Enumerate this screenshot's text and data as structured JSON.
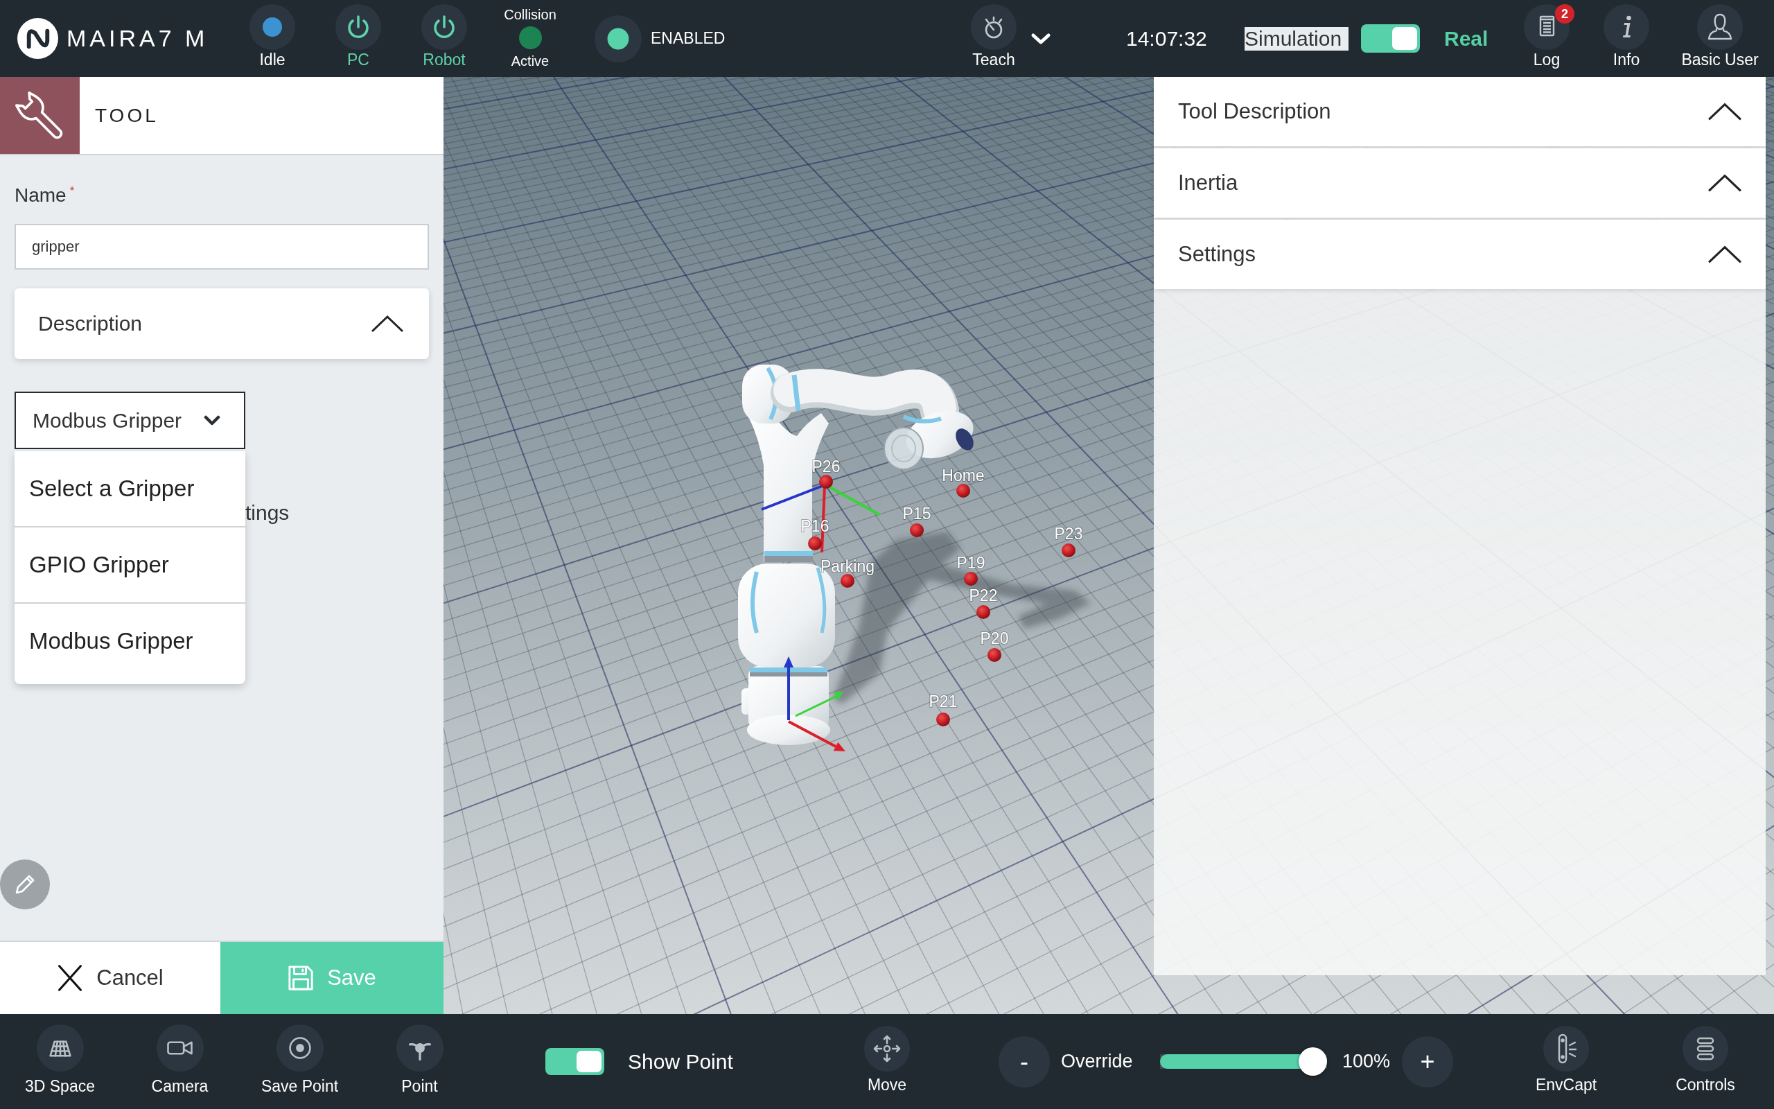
{
  "top_bar": {
    "logo": "MAIRA7 M",
    "status_items": [
      {
        "kind": "dot",
        "label": "Idle",
        "color": "#3b93d1"
      },
      {
        "kind": "power",
        "label": "PC",
        "on": true
      },
      {
        "kind": "power",
        "label": "Robot",
        "on": true
      }
    ],
    "collision": {
      "title": "Collision",
      "state": "Active",
      "active": true
    },
    "enable": {
      "label": "ENABLED",
      "on": true
    },
    "teach": {
      "label": "Teach"
    },
    "clock": "14:07:32",
    "mode_switch": {
      "left_label": "Simulation",
      "right_label": "Real",
      "on": true
    },
    "actions": [
      {
        "kind": "log",
        "label": "Log",
        "badge": "2"
      },
      {
        "kind": "info",
        "label": "Info"
      },
      {
        "kind": "user",
        "label": "Basic User"
      }
    ]
  },
  "tool_panel": {
    "title": "TOOL",
    "name_field": {
      "label": "Name",
      "required_mark": "*",
      "value": "gripper"
    },
    "description": {
      "title": "Description"
    },
    "gripper_select": {
      "value": "Modbus Gripper",
      "open": true,
      "options": [
        {
          "label": "Select a Gripper"
        },
        {
          "label": "GPIO Gripper"
        },
        {
          "label": "Modbus Gripper"
        }
      ]
    },
    "covered_label": "tings",
    "buttons": [
      {
        "kind": "cancel",
        "label": "Cancel"
      },
      {
        "kind": "save",
        "label": "Save"
      }
    ]
  },
  "scene": {
    "points": [
      {
        "label": "P26"
      },
      {
        "label": "Home"
      },
      {
        "label": "P15"
      },
      {
        "label": "P16"
      },
      {
        "label": "P23"
      },
      {
        "label": "Parking"
      },
      {
        "label": "P19"
      },
      {
        "label": "P22"
      },
      {
        "label": "P20"
      },
      {
        "label": "P21"
      }
    ]
  },
  "side_panel": {
    "sections": [
      {
        "title": "Tool Description"
      },
      {
        "title": "Inertia"
      },
      {
        "title": "Settings"
      }
    ]
  },
  "bottom_bar": {
    "tools": [
      {
        "kind": "grid",
        "label": "3D Space"
      },
      {
        "kind": "camera",
        "label": "Camera"
      },
      {
        "kind": "target",
        "label": "Save Point"
      },
      {
        "kind": "point",
        "label": "Point"
      }
    ],
    "show_point": {
      "label": "Show Point",
      "on": true
    },
    "move": {
      "label": "Move"
    },
    "override": {
      "decrease": "-",
      "label": "Override",
      "level": 1,
      "reading": "100%",
      "increase": "+"
    },
    "right_tools": [
      {
        "kind": "scanner",
        "label": "EnvCapt"
      },
      {
        "kind": "controls",
        "label": "Controls"
      }
    ]
  }
}
